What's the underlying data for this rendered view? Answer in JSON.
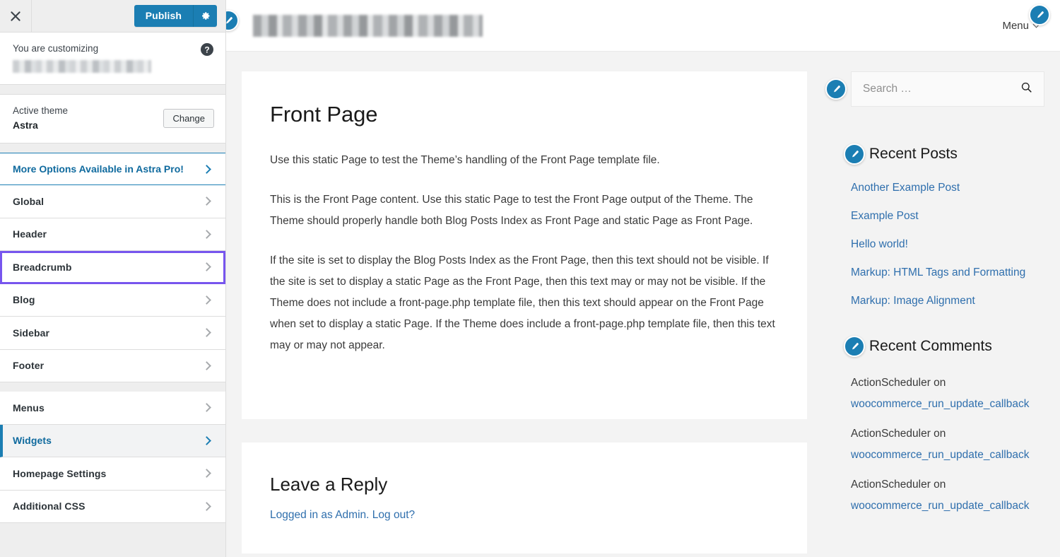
{
  "customizer": {
    "close_label": "Close",
    "publish_label": "Publish",
    "gear_label": "Publish settings",
    "help_label": "Help",
    "you_are_customizing": "You are customizing",
    "site_name_redacted": "",
    "active_theme_label": "Active theme",
    "active_theme_name": "Astra",
    "change_button": "Change",
    "pro_promo": "More Options Available in Astra Pro!",
    "sections_group_1": [
      {
        "label": "Global",
        "state": "default"
      },
      {
        "label": "Header",
        "state": "default"
      },
      {
        "label": "Breadcrumb",
        "state": "focused"
      },
      {
        "label": "Blog",
        "state": "default"
      },
      {
        "label": "Sidebar",
        "state": "default"
      },
      {
        "label": "Footer",
        "state": "default"
      }
    ],
    "sections_group_2": [
      {
        "label": "Menus",
        "state": "default"
      },
      {
        "label": "Widgets",
        "state": "active"
      },
      {
        "label": "Homepage Settings",
        "state": "default"
      },
      {
        "label": "Additional CSS",
        "state": "default"
      }
    ]
  },
  "preview": {
    "site_title_redacted": "",
    "menu_label": "Menu",
    "page_title": "Front Page",
    "paragraphs": [
      "Use this static Page to test the Theme’s handling of the Front Page template file.",
      "This is the Front Page content. Use this static Page to test the Front Page output of the Theme. The Theme should properly handle both Blog Posts Index as Front Page and static Page as Front Page.",
      "If the site is set to display the Blog Posts Index as the Front Page, then this text should not be visible. If the site is set to display a static Page as the Front Page, then this text may or may not be visible. If the Theme does not include a front-page.php template file, then this text should appear on the Front Page when set to display a static Page. If the Theme does include a front-page.php template file, then this text may or may not appear."
    ],
    "comment_form": {
      "title": "Leave a Reply",
      "logged_in_text": "Logged in as Admin.",
      "logout_text": "Log out?"
    },
    "sidebar": {
      "search": {
        "placeholder": "Search …",
        "value": ""
      },
      "recent_posts": {
        "title": "Recent Posts",
        "items": [
          "Another Example Post",
          "Example Post",
          "Hello world!",
          "Markup: HTML Tags and Formatting",
          "Markup: Image Alignment"
        ]
      },
      "recent_comments": {
        "title": "Recent Comments",
        "items": [
          {
            "author": "ActionScheduler on",
            "link": "woocommerce_run_update_callback"
          },
          {
            "author": "ActionScheduler on",
            "link": "woocommerce_run_update_callback"
          },
          {
            "author": "ActionScheduler on",
            "link": "woocommerce_run_update_callback"
          }
        ]
      }
    }
  },
  "colors": {
    "wp_blue": "#1b7eb3",
    "link_blue": "#2f6fad",
    "focus_violet": "#7755ee",
    "sidebar_bg": "#eeeeee",
    "preview_bg": "#f3f3f3"
  }
}
